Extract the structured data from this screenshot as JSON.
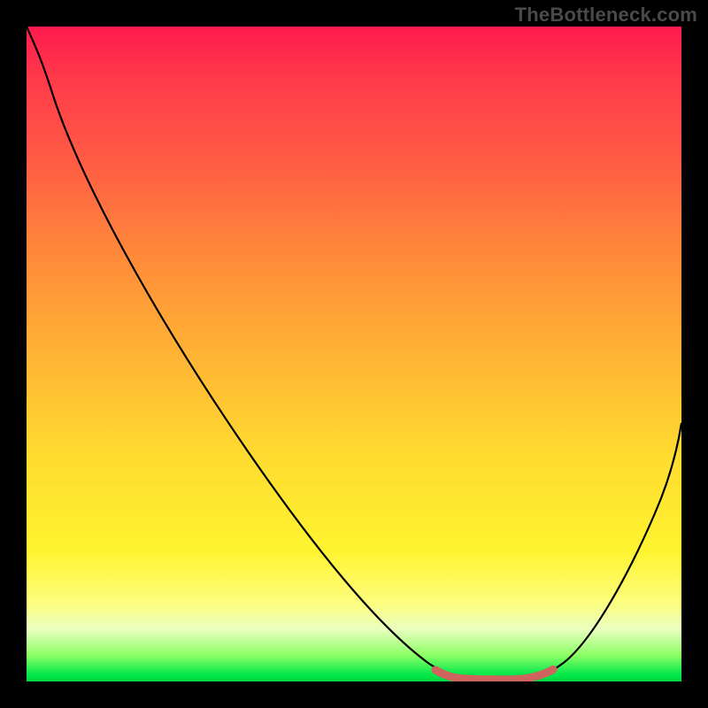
{
  "watermark": "TheBottleneck.com",
  "chart_data": {
    "type": "line",
    "title": "",
    "xlabel": "",
    "ylabel": "",
    "xlim": [
      0,
      100
    ],
    "ylim": [
      0,
      100
    ],
    "series": [
      {
        "name": "bottleneck-curve",
        "x": [
          0,
          3,
          10,
          20,
          30,
          40,
          50,
          60,
          64,
          68,
          72,
          75,
          80,
          85,
          90,
          95,
          100
        ],
        "values": [
          100,
          97,
          88,
          74,
          60,
          46,
          32,
          14,
          6,
          1,
          0.3,
          0.3,
          1,
          6,
          16,
          28,
          40
        ]
      },
      {
        "name": "optimal-band-marker",
        "x": [
          64,
          66,
          68,
          70,
          72,
          74,
          75,
          76,
          77,
          78,
          79,
          80
        ],
        "values": [
          0.7,
          0.5,
          0.4,
          0.4,
          0.4,
          0.4,
          0.4,
          0.5,
          0.6,
          0.8,
          1.0,
          1.2
        ]
      }
    ],
    "colors": {
      "curve": "#000000",
      "marker": "#d16a64",
      "gradient_top": "#ff1a4d",
      "gradient_mid": "#ffdc30",
      "gradient_bottom": "#00d840"
    }
  }
}
